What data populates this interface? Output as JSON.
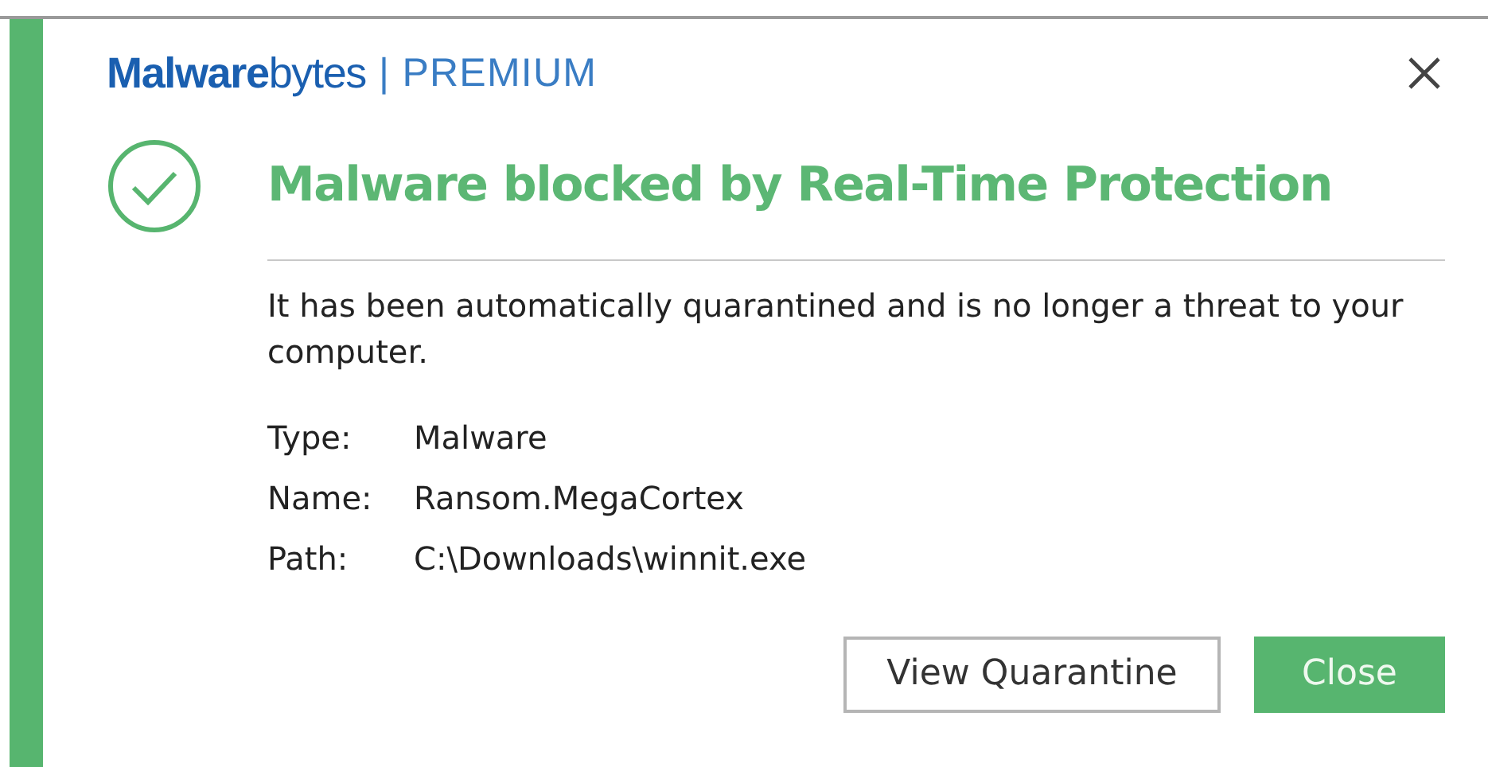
{
  "brand": {
    "name": "**Malware**bytes",
    "edition": "| PREMIUM"
  },
  "title": "Malware blocked by Real-Time Protection",
  "message": "It has been automatically quarantined and is no longer a threat to your computer.",
  "details": [
    {
      "label": "Type:",
      "value": "Malware"
    },
    {
      "label": "Name:",
      "value": "Ransom.MegaCortex"
    },
    {
      "label": "Path:",
      "value": "C:\\Downloads\\winnit.exe"
    }
  ],
  "buttons": [
    {
      "label": "View Quarantine",
      "kind": "secondary"
    },
    {
      "label": "Close",
      "kind": "primary"
    }
  ]
}
